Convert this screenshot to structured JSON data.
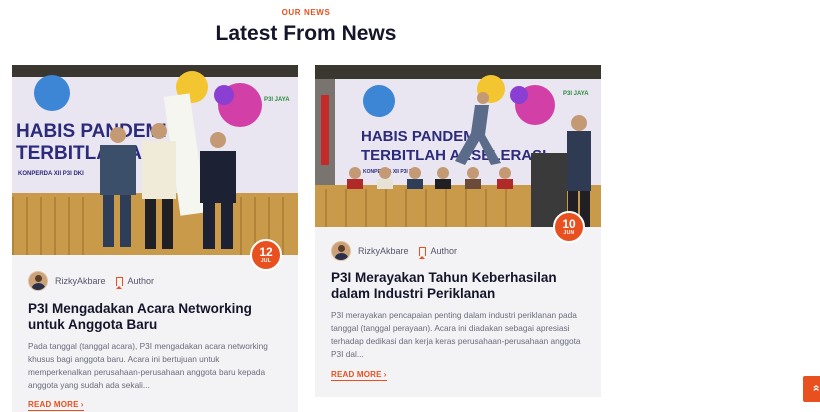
{
  "section": {
    "eyebrow": "OUR NEWS",
    "title": "Latest From News"
  },
  "posts": [
    {
      "day": "12",
      "month": "JUL",
      "author": "RizkyAkbare",
      "role": "Author",
      "title": "P3I Mengadakan Acara Networking untuk Anggota Baru",
      "excerpt": "Pada tanggal (tanggal acara), P3I mengadakan acara networking khusus bagi anggota baru. Acara ini bertujuan untuk memperkenalkan perusahaan-perusahaan anggota baru kepada anggota yang sudah ada sekali...",
      "read_more": "READ MORE",
      "banner_line1": "HABIS PANDEMI",
      "banner_line2": "TERBITLAH AKS",
      "banner_sub": "KONPERDA XII P3I DKI",
      "banner_logo": "P3I JAYA"
    },
    {
      "day": "10",
      "month": "JUN",
      "author": "RizkyAkbare",
      "role": "Author",
      "title": "P3I Merayakan Tahun Keberhasilan dalam Industri Periklanan",
      "excerpt": "P3I merayakan pencapaian penting dalam industri periklanan pada tanggal (tanggal perayaan). Acara ini diadakan sebagai apresiasi terhadap dedikasi dan kerja keras perusahaan-perusahaan anggota P3I dal...",
      "read_more": "READ MORE",
      "banner_line1": "HABIS PANDEMI",
      "banner_line2": "TERBITLAH AKSELERASI",
      "banner_sub": "KONPERDA XII P3I DKI",
      "banner_logo": "P3I JAYA"
    }
  ],
  "scroll_top_icon": "double-chevron-up-icon",
  "colors": {
    "accent": "#e8501f",
    "heading": "#15152a",
    "card_bg": "#f3f3f5"
  }
}
